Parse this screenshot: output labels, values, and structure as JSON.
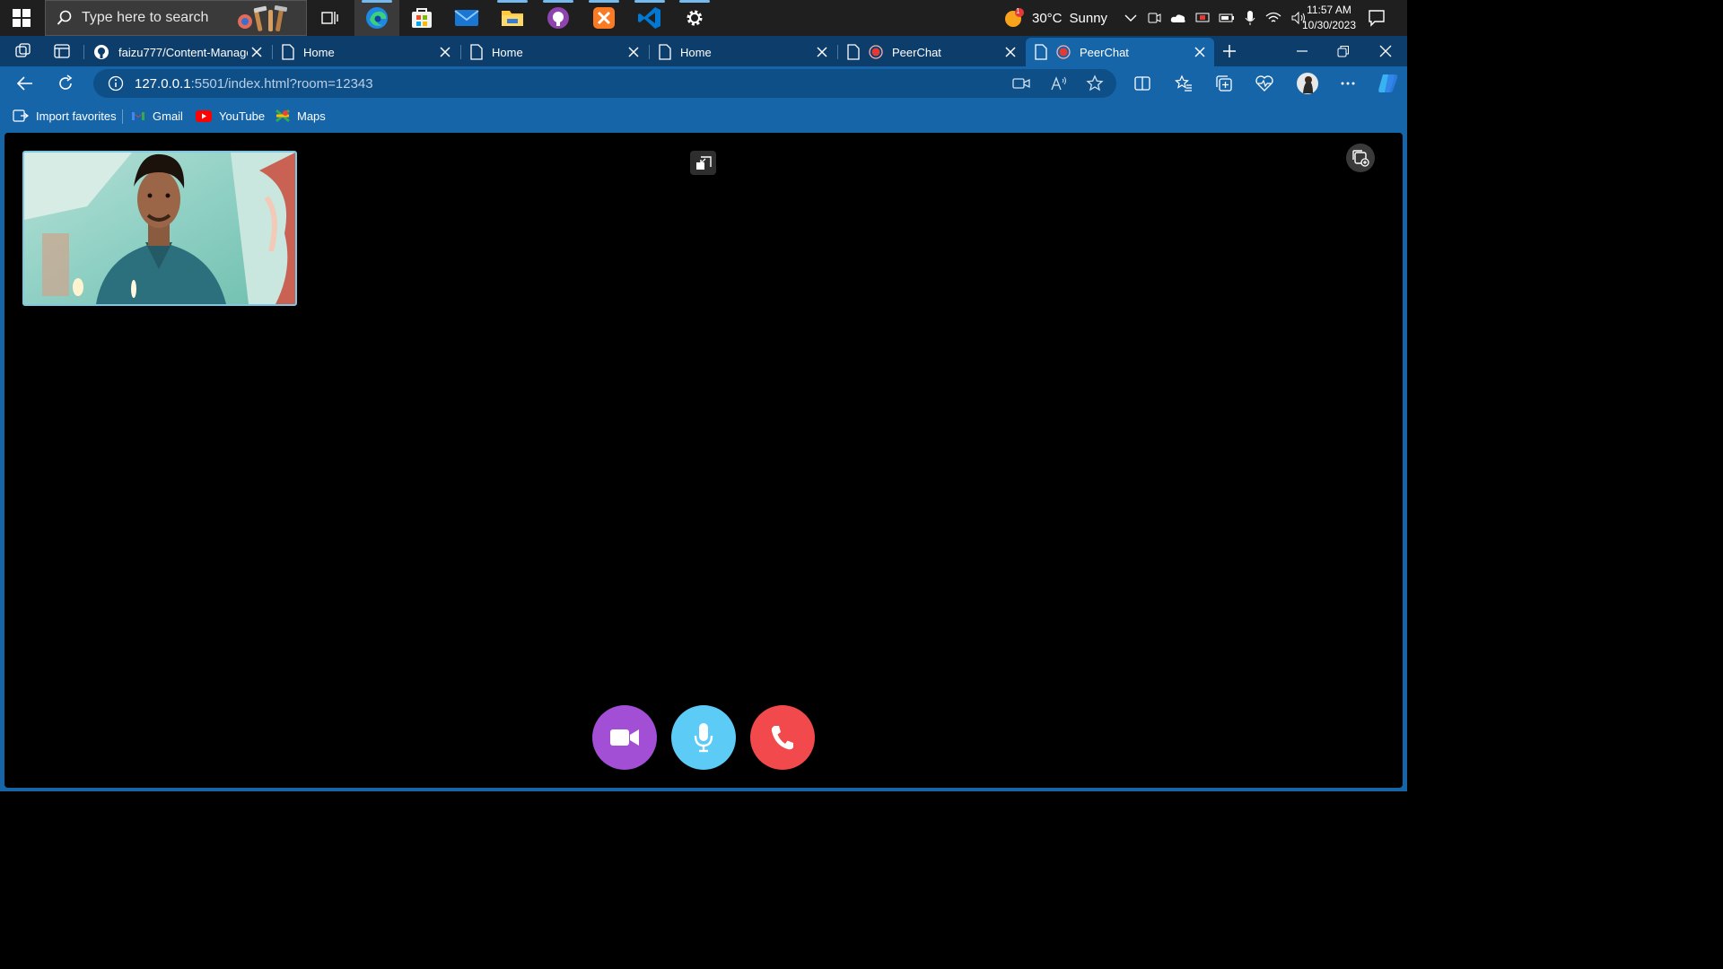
{
  "taskbar": {
    "search_placeholder": "Type here to search",
    "weather_temp": "30°C",
    "weather_cond": "Sunny",
    "weather_badge": "1",
    "time": "11:57 AM",
    "date": "10/30/2023"
  },
  "tabs": [
    {
      "label": "faizu777/Content-Manage",
      "icon": "github-icon"
    },
    {
      "label": "Home",
      "icon": "page-icon"
    },
    {
      "label": "Home",
      "icon": "page-icon"
    },
    {
      "label": "Home",
      "icon": "page-icon"
    },
    {
      "label": "PeerChat",
      "icon": "recording-icon"
    },
    {
      "label": "PeerChat",
      "icon": "recording-icon",
      "active": true
    }
  ],
  "address": {
    "host": "127.0.0.1",
    "rest": ":5501/index.html?room=12343"
  },
  "favorites": {
    "import": "Import favorites",
    "gmail": "Gmail",
    "youtube": "YouTube",
    "maps": "Maps"
  },
  "colors": {
    "camera_button": "#a24fd6",
    "mic_button": "#5ccbf5",
    "hangup_button": "#f2494d",
    "browser_accent": "#1565a8"
  }
}
